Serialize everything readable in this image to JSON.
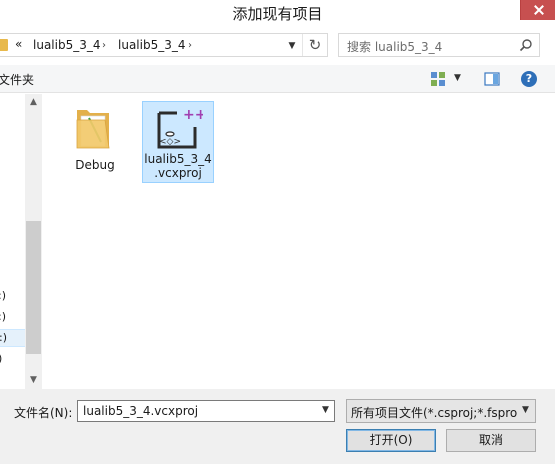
{
  "window": {
    "title": "添加现有项目"
  },
  "address_bar": {
    "overflow": "«",
    "crumbs": [
      "lualib5_3_4",
      "lualib5_3_4"
    ],
    "separator": "›"
  },
  "search": {
    "placeholder": "搜索 lualib5_3_4"
  },
  "command_bar": {
    "new_folder": "文件夹"
  },
  "nav": {
    "drive_items": [
      ":)",
      ":)",
      ":)",
      ")"
    ]
  },
  "files": [
    {
      "name": "Debug",
      "type": "folder",
      "selected": false
    },
    {
      "name": "lualib5_3_4\n.vcxproj",
      "line1": "lualib5_3_4",
      "line2": ".vcxproj",
      "type": "vcxproj",
      "selected": true
    }
  ],
  "footer": {
    "filename_label": "文件名(N):",
    "filename_value": "lualib5_3_4.vcxproj",
    "filetype_value": "所有项目文件(*.csproj;*.fsproj",
    "open_label": "打开(O)",
    "cancel_label": "取消"
  },
  "colors": {
    "selection": "#cce8ff",
    "close": "#c75050",
    "folder": "#e8b94c"
  },
  "icons": [
    "close-icon",
    "folder-icon",
    "refresh-icon",
    "search-icon",
    "view-icon",
    "preview-pane-icon",
    "help-icon",
    "vcxproj-icon"
  ]
}
